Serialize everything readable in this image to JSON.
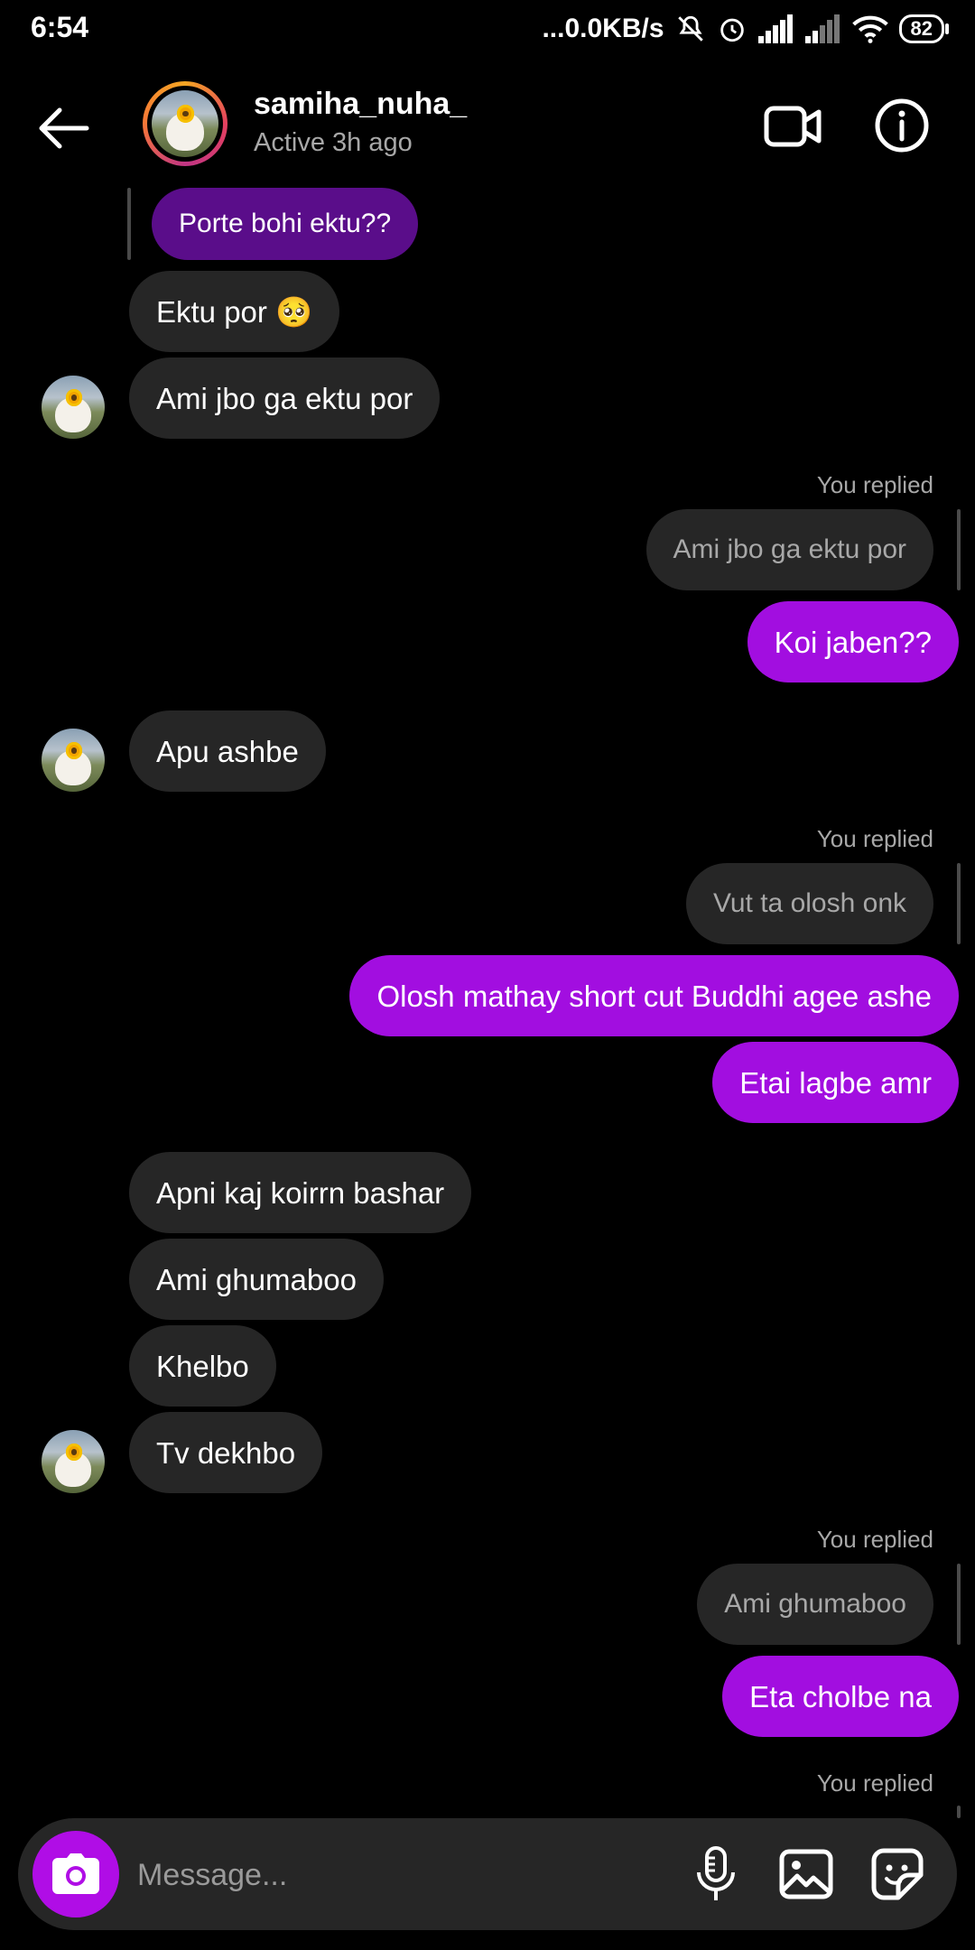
{
  "status_bar": {
    "time": "6:54",
    "net_speed": "...0.0KB/s",
    "battery": "82"
  },
  "header": {
    "username": "samiha_nuha_",
    "activity": "Active 3h ago"
  },
  "messages": {
    "m0_quoted": "Porte bohi ektu??",
    "m1": "Ektu por 🥺",
    "m2": "Ami jbo ga ektu por",
    "r1_label": "You replied",
    "r1_quote": "Ami jbo ga ektu por",
    "m3": "Koi jaben??",
    "m4": "Apu ashbe",
    "r2_label": "You replied",
    "r2_quote": "Vut ta olosh onk",
    "m5": "Olosh mathay short cut Buddhi agee ashe",
    "m6": "Etai lagbe amr",
    "m7": "Apni kaj koirrn bashar",
    "m8": "Ami ghumaboo",
    "m9": "Khelbo",
    "m10": "Tv dekhbo",
    "r3_label": "You replied",
    "r3_quote": "Ami ghumaboo",
    "m11": "Eta cholbe na",
    "r4_label": "You replied"
  },
  "composer": {
    "placeholder": "Message..."
  },
  "icons": {
    "back": "arrow-left-icon",
    "video": "video-camera-icon",
    "info": "info-icon",
    "camera": "camera-icon",
    "mic": "microphone-icon",
    "gallery": "image-icon",
    "sticker": "sticker-icon"
  },
  "colors": {
    "background": "#000000",
    "incoming_bubble": "#262626",
    "outgoing_bubble": "#a20ee0",
    "secondary_text": "#a8a8a8"
  }
}
